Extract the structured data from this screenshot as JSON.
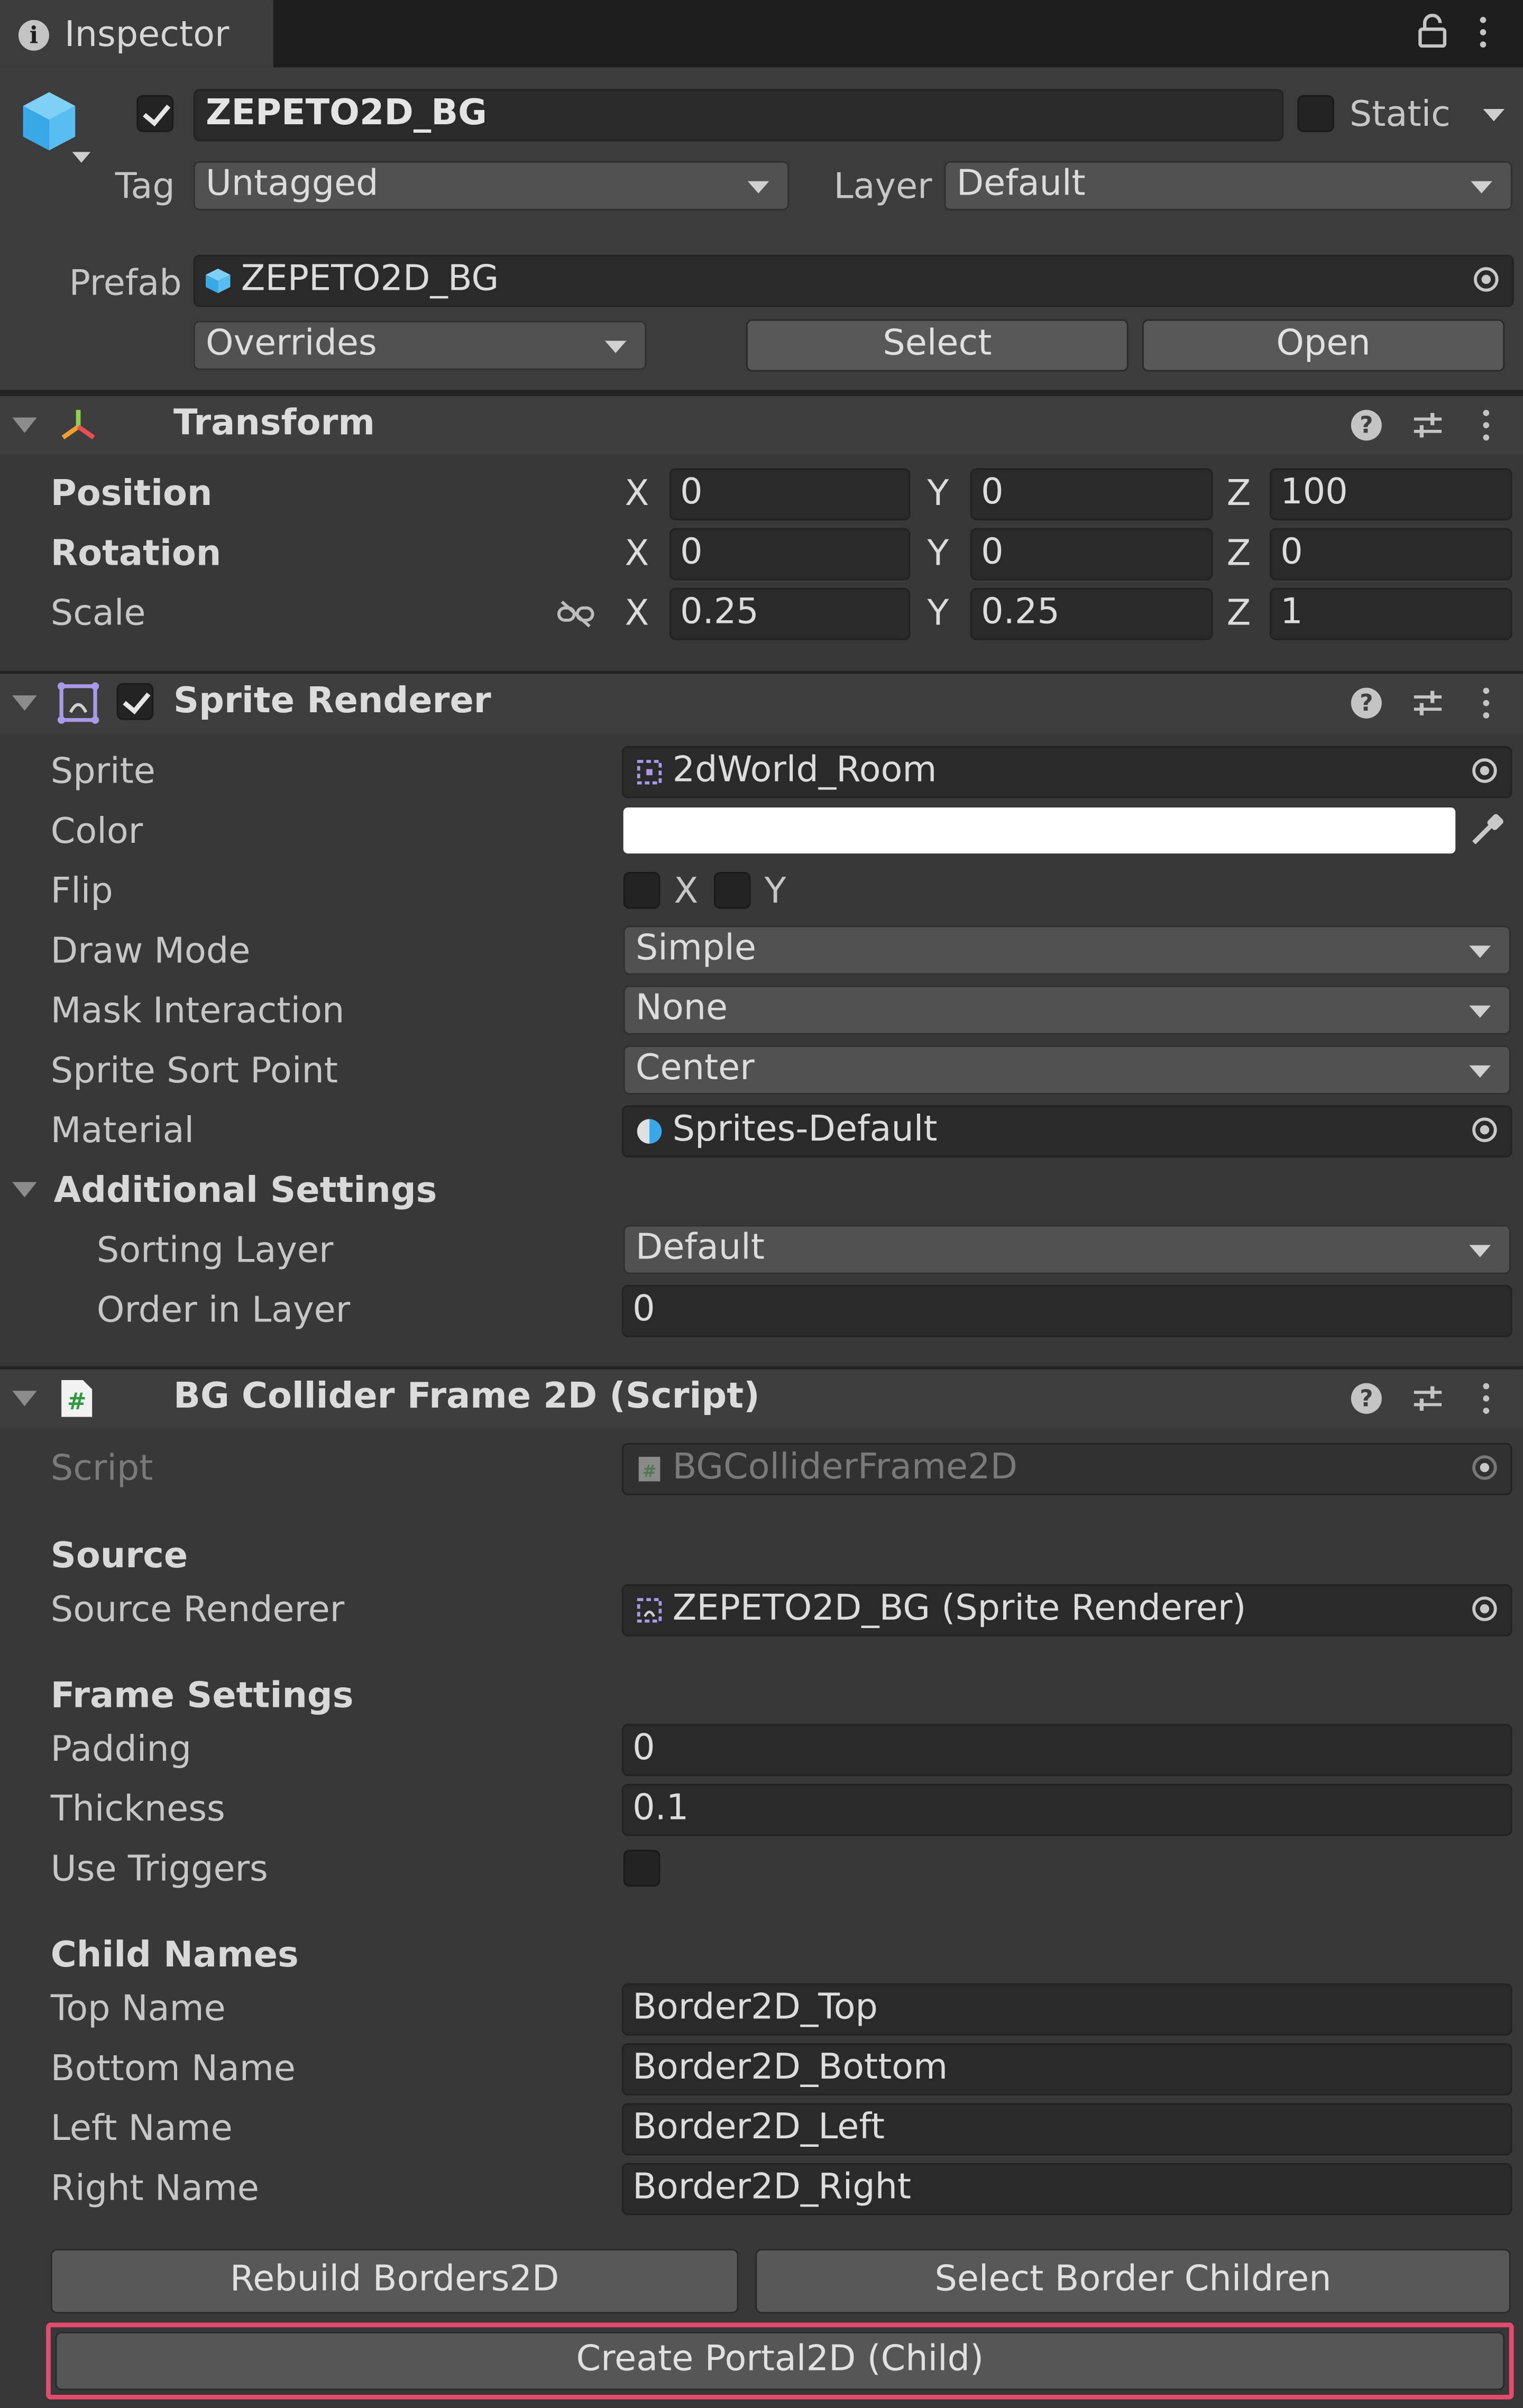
{
  "tab": {
    "label": "Inspector"
  },
  "header": {
    "object_name": "ZEPETO2D_BG",
    "static_label": "Static",
    "tag_label": "Tag",
    "tag_value": "Untagged",
    "layer_label": "Layer",
    "layer_value": "Default",
    "prefab_label": "Prefab",
    "prefab_value": "ZEPETO2D_BG",
    "overrides_label": "Overrides",
    "select_label": "Select",
    "open_label": "Open"
  },
  "transform": {
    "title": "Transform",
    "position_label": "Position",
    "rotation_label": "Rotation",
    "scale_label": "Scale",
    "axis_x": "X",
    "axis_y": "Y",
    "axis_z": "Z",
    "position": {
      "x": "0",
      "y": "0",
      "z": "100"
    },
    "rotation": {
      "x": "0",
      "y": "0",
      "z": "0"
    },
    "scale": {
      "x": "0.25",
      "y": "0.25",
      "z": "1"
    }
  },
  "sprite_renderer": {
    "title": "Sprite Renderer",
    "sprite_label": "Sprite",
    "sprite_value": "2dWorld_Room",
    "color_label": "Color",
    "color_value": "#ffffff",
    "flip_label": "Flip",
    "flip_x": "X",
    "flip_y": "Y",
    "draw_mode_label": "Draw Mode",
    "draw_mode_value": "Simple",
    "mask_label": "Mask Interaction",
    "mask_value": "None",
    "sort_point_label": "Sprite Sort Point",
    "sort_point_value": "Center",
    "material_label": "Material",
    "material_value": "Sprites-Default",
    "additional_label": "Additional Settings",
    "sorting_layer_label": "Sorting Layer",
    "sorting_layer_value": "Default",
    "order_label": "Order in Layer",
    "order_value": "0"
  },
  "bg_collider": {
    "title": "BG Collider Frame 2D (Script)",
    "script_label": "Script",
    "script_value": "BGColliderFrame2D",
    "source_header": "Source",
    "source_renderer_label": "Source Renderer",
    "source_renderer_value": "ZEPETO2D_BG (Sprite Renderer)",
    "frame_header": "Frame Settings",
    "padding_label": "Padding",
    "padding_value": "0",
    "thickness_label": "Thickness",
    "thickness_value": "0.1",
    "use_triggers_label": "Use Triggers",
    "child_names_header": "Child Names",
    "top_label": "Top Name",
    "top_value": "Border2D_Top",
    "bottom_label": "Bottom Name",
    "bottom_value": "Border2D_Bottom",
    "left_label": "Left Name",
    "left_value": "Border2D_Left",
    "right_label": "Right Name",
    "right_value": "Border2D_Right",
    "rebuild_label": "Rebuild Borders2D",
    "select_children_label": "Select Border Children",
    "create_portal_label": "Create Portal2D (Child)"
  },
  "colors": {
    "highlight": "#e64a6c",
    "panel": "#383838",
    "field": "#2a2a2a"
  }
}
